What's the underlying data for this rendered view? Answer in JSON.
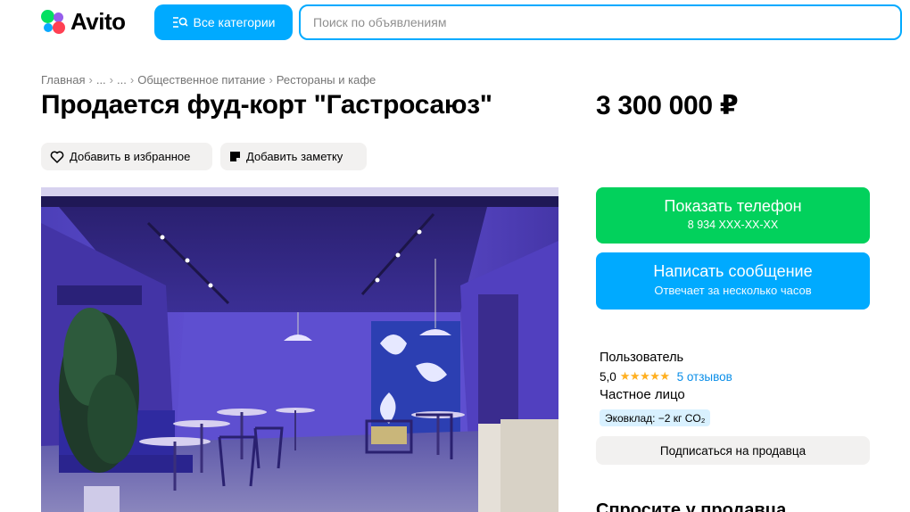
{
  "header": {
    "logo_text": "Avito",
    "categories_label": "Все категории",
    "search_placeholder": "Поиск по объявлениям"
  },
  "breadcrumb": [
    "Главная",
    "...",
    "...",
    "Общественное питание",
    "Рестораны и кафе"
  ],
  "listing": {
    "title": "Продается фуд-корт \"Гастросаюз\"",
    "price": "3 300 000 ₽",
    "favorite_label": "Добавить в избранное",
    "note_label": "Добавить заметку"
  },
  "contact": {
    "phone_title": "Показать телефон",
    "phone_number": "8 934 XXX-XX-XX",
    "message_title": "Написать сообщение",
    "message_subtitle": "Отвечает за несколько часов"
  },
  "seller": {
    "role": "Пользователь",
    "rating": "5,0",
    "stars": 5,
    "reviews": "5 отзывов",
    "type": "Частное лицо",
    "eco_badge": "Эковклад: −2 кг CO₂",
    "subscribe_label": "Подписаться на продавца",
    "ask_title": "Спросите у продавца"
  },
  "colors": {
    "brand_blue": "#00aaff",
    "phone_green": "#02d15c",
    "star": "#ffb021",
    "link": "#0a8ee8"
  }
}
